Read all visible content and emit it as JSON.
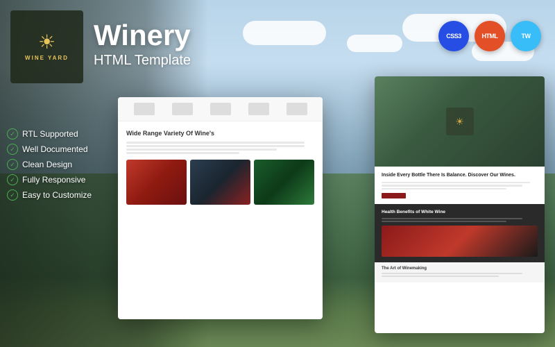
{
  "background": {
    "sky_color_top": "#b8d4e8",
    "sky_color_bottom": "#6a8fa5",
    "hills_color": "#4a7050"
  },
  "logo": {
    "icon": "☀",
    "text": "WINE YARD"
  },
  "header": {
    "title": "Winery",
    "subtitle": "HTML Template"
  },
  "tech_badges": [
    {
      "name": "CSS3",
      "label": "CSS3",
      "color": "#264de4"
    },
    {
      "name": "HTML5",
      "label": "HTML",
      "color": "#e34f26"
    },
    {
      "name": "Tailwind",
      "label": "TW",
      "color": "#38bdf8"
    }
  ],
  "features": [
    {
      "label": "RTL Supported"
    },
    {
      "label": "Well Documented"
    },
    {
      "label": "Clean Design"
    },
    {
      "label": "Fully Responsive"
    },
    {
      "label": "Easy to Customize"
    }
  ],
  "preview_left": {
    "section_title": "Wide Range Variety Of Wine's",
    "text_lines": [
      "line1",
      "line2",
      "line3",
      "line4"
    ]
  },
  "preview_right": {
    "hero_title": "Inside Every Bottle There Is Balance. Discover Our Wines.",
    "section2_title": "Health Benefits of White Wine",
    "section3_title": "The Art of Winemaking"
  }
}
